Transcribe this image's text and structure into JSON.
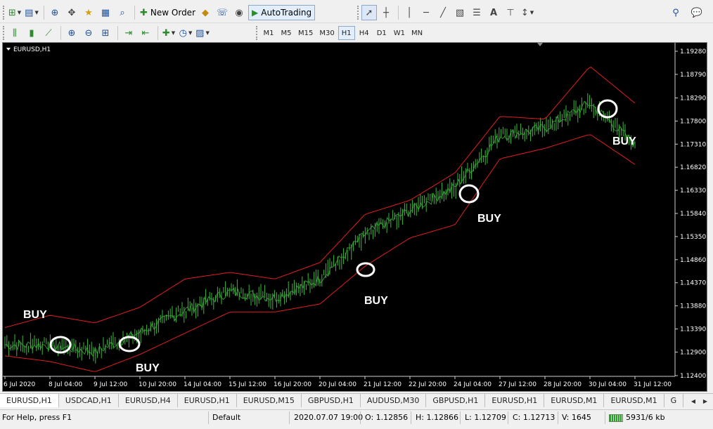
{
  "toolbar": {
    "new_order_label": "New Order",
    "autotrading_label": "AutoTrading"
  },
  "timeframes": [
    "M1",
    "M5",
    "M15",
    "M30",
    "H1",
    "H4",
    "D1",
    "W1",
    "MN"
  ],
  "active_timeframe": "H1",
  "chart": {
    "title": "EURUSD,H1",
    "background": "#000000",
    "bar_color": "#3cb83c",
    "band_color": "#e11e1e",
    "annotation_color": "#ffffff",
    "price_labels": [
      "1.19280",
      "1.18790",
      "1.18290",
      "1.17800",
      "1.17310",
      "1.16820",
      "1.16330",
      "1.15840",
      "1.15350",
      "1.14860",
      "1.14370",
      "1.13880",
      "1.13390",
      "1.12900",
      "1.12400"
    ],
    "time_labels": [
      "6 Jul 2020",
      "8 Jul 04:00",
      "9 Jul 12:00",
      "10 Jul 20:00",
      "14 Jul 04:00",
      "15 Jul 12:00",
      "16 Jul 20:00",
      "20 Jul 04:00",
      "21 Jul 12:00",
      "22 Jul 20:00",
      "24 Jul 04:00",
      "27 Jul 12:00",
      "28 Jul 20:00",
      "30 Jul 04:00",
      "31 Jul 12:00"
    ],
    "annotations": [
      "BUY",
      "BUY",
      "BUY",
      "BUY",
      "BUY"
    ]
  },
  "chart_data": {
    "type": "line",
    "title": "EURUSD,H1",
    "x": [
      "6 Jul 2020",
      "8 Jul 04:00",
      "9 Jul 12:00",
      "10 Jul 20:00",
      "14 Jul 04:00",
      "15 Jul 12:00",
      "16 Jul 20:00",
      "20 Jul 04:00",
      "21 Jul 12:00",
      "22 Jul 20:00",
      "24 Jul 04:00",
      "27 Jul 12:00",
      "28 Jul 20:00",
      "30 Jul 04:00",
      "31 Jul 12:00"
    ],
    "ylim": [
      1.124,
      1.1928
    ],
    "series": [
      {
        "values": [
          1.1305,
          1.1305,
          1.129,
          1.1332,
          1.1378,
          1.1418,
          1.1405,
          1.1445,
          1.154,
          1.159,
          1.164,
          1.1748,
          1.1765,
          1.1818,
          1.173
        ]
      },
      {
        "values": [
          1.1342,
          1.1368,
          1.1352,
          1.1385,
          1.1445,
          1.1459,
          1.1445,
          1.148,
          1.1582,
          1.1612,
          1.167,
          1.179,
          1.1784,
          1.1896,
          1.1818
        ]
      },
      {
        "values": [
          1.1282,
          1.127,
          1.1248,
          1.1285,
          1.133,
          1.1375,
          1.1375,
          1.1392,
          1.1472,
          1.1532,
          1.156,
          1.17,
          1.1722,
          1.1752,
          1.1688
        ]
      }
    ]
  },
  "tabs": [
    "EURUSD,H1",
    "USDCAD,H1",
    "EURUSD,H4",
    "EURUSD,H1",
    "EURUSD,M15",
    "GBPUSD,H1",
    "AUDUSD,M30",
    "GBPUSD,H1",
    "EURUSD,H1",
    "EURUSD,M1",
    "EURUSD,M1",
    "G"
  ],
  "status": {
    "help": "For Help, press F1",
    "profile": "Default",
    "datetime": "2020.07.07 19:00",
    "open": "O: 1.12856",
    "high": "H: 1.12866",
    "low": "L: 1.12709",
    "close": "C: 1.12713",
    "volume": "V: 1645",
    "traffic": "5931/6 kb"
  }
}
